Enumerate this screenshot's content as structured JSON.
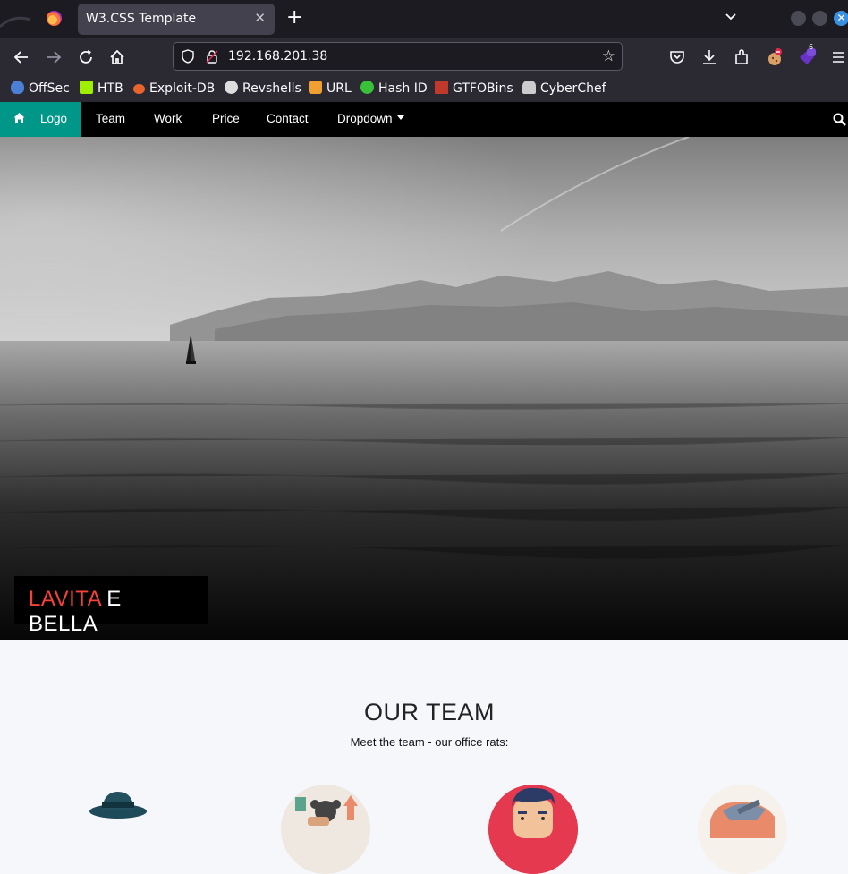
{
  "browser": {
    "tab_title": "W3.CSS Template",
    "url": "192.168.201.38",
    "extension_badge": "6",
    "bookmarks": [
      {
        "label": "OffSec",
        "color": "#4a7fd4"
      },
      {
        "label": "HTB",
        "color": "#9fef00"
      },
      {
        "label": "Exploit-DB",
        "color": "#e8642c"
      },
      {
        "label": "Revshells",
        "color": "#dddddd"
      },
      {
        "label": "URL",
        "color": "#f0a030"
      },
      {
        "label": "Hash ID",
        "color": "#39c139"
      },
      {
        "label": "GTFOBins",
        "color": "#c0392b"
      },
      {
        "label": "CyberChef",
        "color": "#cccccc"
      }
    ]
  },
  "site_nav": {
    "logo": "Logo",
    "links": [
      "Team",
      "Work",
      "Price",
      "Contact",
      "Dropdown"
    ],
    "accent": "#009688"
  },
  "hero": {
    "title_red": "LAVITA",
    "title_white": "E BELLA",
    "accent": "#f44336"
  },
  "team": {
    "heading": "OUR TEAM",
    "subtitle": "Meet the team - our office rats:"
  }
}
